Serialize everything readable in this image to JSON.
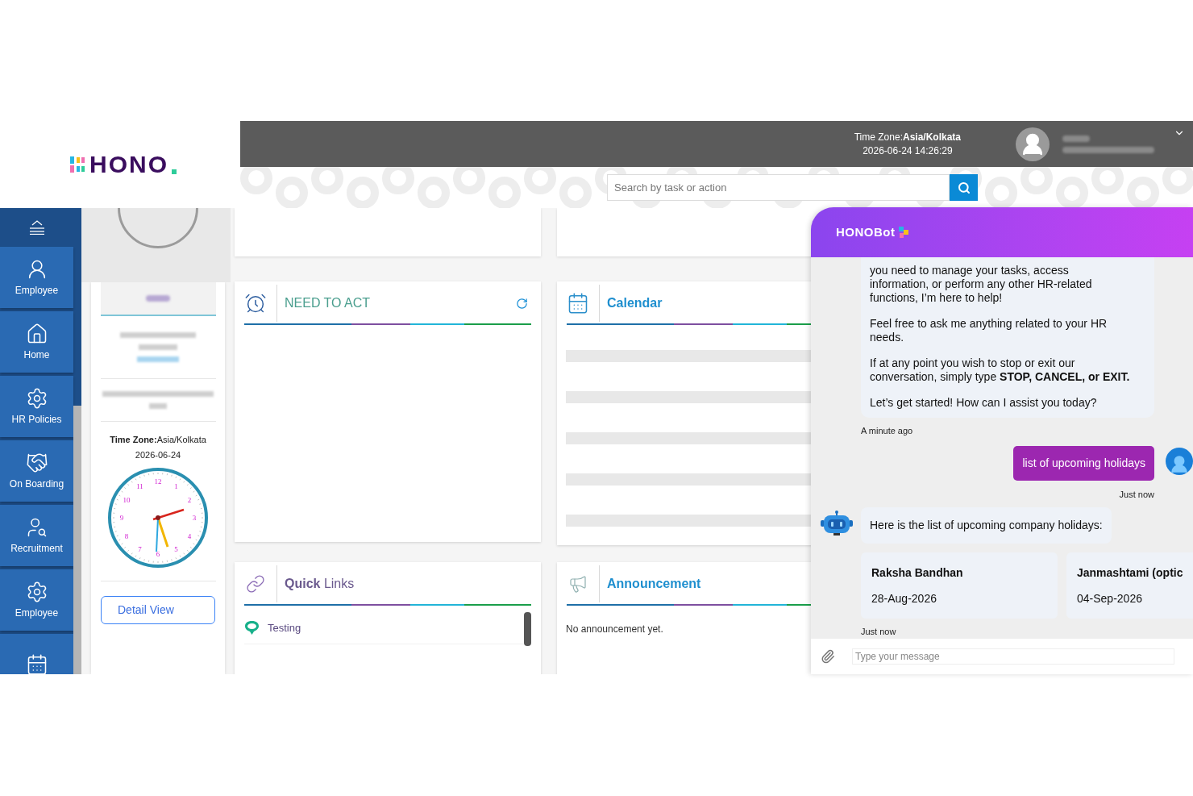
{
  "logo": {
    "text": "HONO"
  },
  "sidebar": {
    "expanded": true,
    "items": [
      {
        "label": "Employee",
        "kind": "person",
        "selected": false
      },
      {
        "label": "Home",
        "kind": "home",
        "selected": false
      },
      {
        "label": "HR Policies",
        "kind": "gear",
        "selected": false
      },
      {
        "label": "On Boarding",
        "kind": "handshake",
        "selected": false
      },
      {
        "label": "Recruitment",
        "kind": "search-person",
        "selected": false
      },
      {
        "label": "Employee",
        "kind": "gear",
        "selected": false
      },
      {
        "kind": "calendar",
        "selected": false
      }
    ]
  },
  "header": {
    "timezone_label": "Time Zone:",
    "timezone": "Asia/Kolkata",
    "datetime": "2026-06-24 14:26:29"
  },
  "search": {
    "placeholder": "Search by task or action"
  },
  "profile": {
    "timezone_label": "Time Zone:",
    "timezone": "Asia/Kolkata",
    "date": "2026-06-24",
    "clock_numbers": [
      "12",
      "1",
      "2",
      "3",
      "4",
      "5",
      "6",
      "7",
      "8",
      "9",
      "10",
      "11"
    ],
    "detail_button": "Detail View"
  },
  "need_to_act": {
    "title": "NEED TO ACT"
  },
  "calendar": {
    "title": "Calendar"
  },
  "quick_links": {
    "title": "**Quick** Links",
    "items": [
      "Testing"
    ]
  },
  "announcement": {
    "title": "Announcement",
    "empty_text": "No announcement yet."
  },
  "chat": {
    "title": "HONOBot",
    "input_placeholder": "Type your message",
    "messages": [
      {
        "kind": "bot_text",
        "paragraphs": [
          "you need to manage your tasks, access information, or perform any other HR-related functions, I’m here to help!",
          "Feel free to ask me anything related to your HR needs.",
          "If at any point you wish to stop or exit our conversation, simply type **STOP, CANCEL, or EXIT.**",
          "Let’s get started! How can I assist you today?"
        ],
        "time": "A minute ago"
      },
      {
        "kind": "user",
        "text": "list of upcoming holidays",
        "time": "Just now"
      },
      {
        "kind": "bot_reply",
        "text": "Here is the list of upcoming company holidays:",
        "holidays": [
          {
            "name": "Raksha Bandhan",
            "date": "28-Aug-2026"
          },
          {
            "name": "Janmashtami (optic",
            "date": "04-Sep-2026"
          }
        ],
        "time": "Just now"
      }
    ]
  }
}
